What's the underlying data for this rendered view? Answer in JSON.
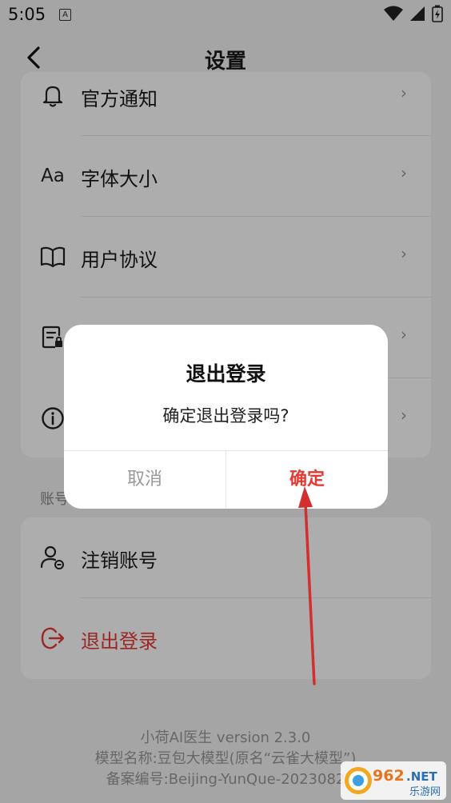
{
  "status_bar": {
    "time": "5:05",
    "notification_letter": "A"
  },
  "app_bar": {
    "title": "设置"
  },
  "settings_rows": [
    {
      "icon": "bell-icon",
      "label": "官方通知"
    },
    {
      "icon": "font-size-icon",
      "icon_text": "Aa",
      "label": "字体大小"
    },
    {
      "icon": "book-icon",
      "label": "用户协议"
    },
    {
      "icon": "privacy-doc-icon",
      "label": ""
    },
    {
      "icon": "info-icon",
      "label": ""
    }
  ],
  "chevron": "›",
  "account_section": {
    "title": "账号",
    "items": [
      {
        "icon": "user-cancel-icon",
        "label": "注销账号"
      },
      {
        "icon": "logout-icon",
        "label": "退出登录"
      }
    ]
  },
  "footer": {
    "line1": "小荷AI医生 version 2.3.0",
    "line2": "模型名称:豆包大模型(原名“云雀大模型”)",
    "line3": "备案编号:Beijing-YunQue-2023082"
  },
  "dialog": {
    "title": "退出登录",
    "message": "确定退出登录吗?",
    "cancel_label": "取消",
    "confirm_label": "确定"
  },
  "watermark": {
    "brand": "962",
    "domain": ".NET",
    "site": "乐游网"
  },
  "colors": {
    "accent_red": "#e53935",
    "background": "#f3f3f5",
    "card": "#ffffff"
  }
}
